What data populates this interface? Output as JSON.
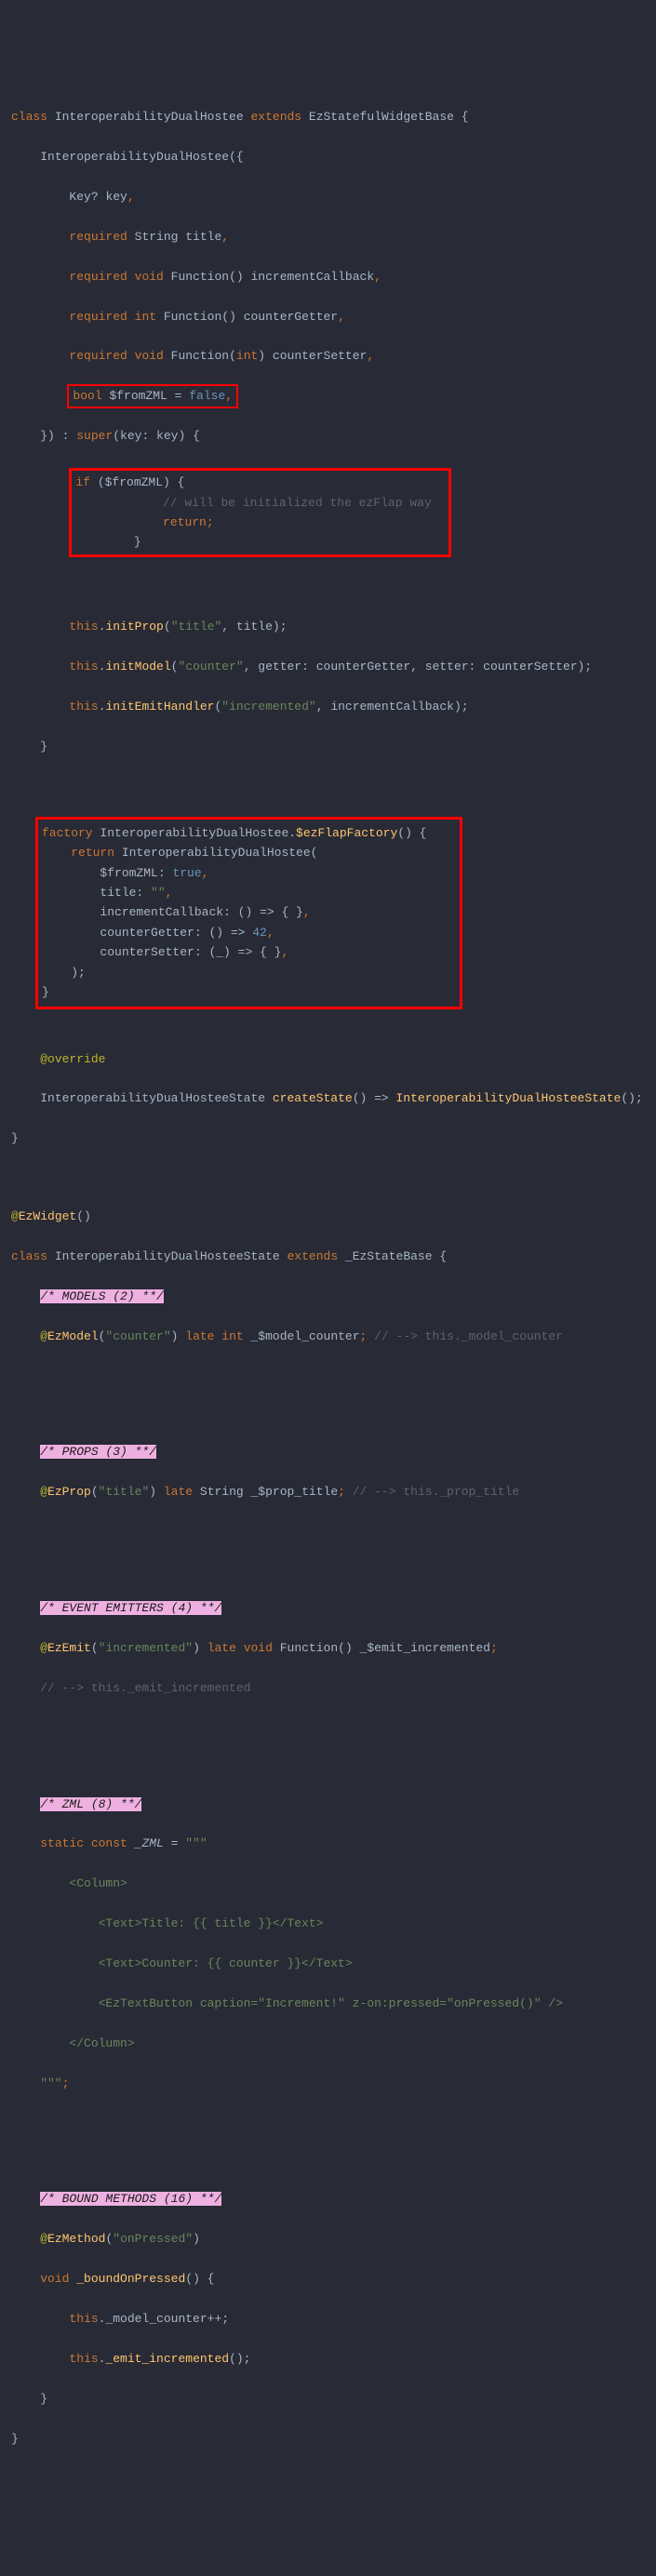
{
  "code": {
    "l1": {
      "class_kw": "class",
      "cls": "InteroperabilityDualHostee",
      "ext": "extends",
      "base": "EzStatefulWidgetBase",
      "brace": " {"
    },
    "l2": {
      "ctor": "InteroperabilityDualHostee",
      "open": "({"
    },
    "l3": {
      "type": "Key?",
      "name": " key",
      "c": ","
    },
    "l4": {
      "req": "required",
      "type": " String",
      "name": " title",
      "c": ","
    },
    "l5": {
      "req": "required",
      "type": " void ",
      "fn": "Function",
      "sig": "()",
      "name": " incrementCallback",
      "c": ","
    },
    "l6": {
      "req": "required",
      "type": " int ",
      "fn": "Function",
      "sig": "()",
      "name": " counterGetter",
      "c": ","
    },
    "l7": {
      "req": "required",
      "type": " void ",
      "fn": "Function",
      "sig": "(",
      "pt": "int",
      "sig2": ")",
      "name": " counterSetter",
      "c": ","
    },
    "l8": {
      "type": "bool",
      "name": " $fromZML = ",
      "val": "false",
      "c": ","
    },
    "l9": {
      "close": "}) : ",
      "superkw": "super",
      "args": "(key: key) {"
    },
    "l10": {
      "ifkw": "if ",
      "cond": "($fromZML) {"
    },
    "l11": {
      "cm": "// will be initialized the ezFlap way"
    },
    "l12": {
      "ret": "return",
      "sc": ";"
    },
    "l13": {
      "close": "}"
    },
    "l15": {
      "thiskw": "this",
      "dot": ".",
      "fn": "initProp",
      "open": "(",
      "s1": "\"title\"",
      "comma": ", title);"
    },
    "l16": {
      "thiskw": "this",
      "dot": ".",
      "fn": "initModel",
      "open": "(",
      "s1": "\"counter\"",
      "mid": ", getter: counterGetter, setter: counterSetter);"
    },
    "l17": {
      "thiskw": "this",
      "dot": ".",
      "fn": "initEmitHandler",
      "open": "(",
      "s1": "\"incremented\"",
      "mid": ", incrementCallback);"
    },
    "l18": {
      "close": "}"
    },
    "fac": {
      "l1": {
        "fac": "factory",
        "name": " InteroperabilityDualHostee.",
        "mname": "$ezFlapFactory",
        "sig": "() {"
      },
      "l2": {
        "ret": "return ",
        "ctor": "InteroperabilityDualHostee",
        "open": "("
      },
      "l3": {
        "k": "$fromZML: ",
        "v": "true",
        "c": ","
      },
      "l4": {
        "k": "title: ",
        "v": "\"\"",
        "c": ","
      },
      "l5": {
        "k": "incrementCallback: () => { }",
        "c": ","
      },
      "l6": {
        "k": "counterGetter: () => ",
        "v": "42",
        "c": ","
      },
      "l7": {
        "k": "counterSetter: (_) => { }",
        "c": ","
      },
      "l8": {
        "close": ");"
      },
      "l9": {
        "close": "}"
      }
    },
    "ov": {
      "ann": "@override"
    },
    "cs": {
      "ret": "InteroperabilityDualHosteeState ",
      "fn": "createState",
      "mid": "() => ",
      "ctor": "InteroperabilityDualHosteeState",
      "end": "();"
    },
    "end1": {
      "close": "}"
    },
    "wann": {
      "ann": "@",
      "fn": "EzWidget",
      "end": "()"
    },
    "cls2": {
      "class_kw": "class",
      "cls": "InteroperabilityDualHosteeState",
      "ext": "extends",
      "base": "_EzStateBase",
      "brace": " {"
    },
    "sec_models": "/* MODELS (2) **/",
    "mod1": {
      "ann": "@",
      "fn": "EzModel",
      "open": "(",
      "s": "\"counter\"",
      "close": ") ",
      "late": "late ",
      "t": "int",
      "name": " _$model_counter",
      "sc": ";",
      "cm": " // --> this._model_counter"
    },
    "sec_props": "/* PROPS (3) **/",
    "prop1": {
      "ann": "@",
      "fn": "EzProp",
      "open": "(",
      "s": "\"title\"",
      "close": ") ",
      "late": "late ",
      "t": "String",
      "name": " _$prop_title",
      "sc": ";",
      "cm": " // --> this._prop_title"
    },
    "sec_emit": "/* EVENT EMITTERS (4) **/",
    "emit1": {
      "ann": "@",
      "fn": "EzEmit",
      "open": "(",
      "s": "\"incremented\"",
      "close": ") ",
      "late": "late ",
      "t": "void ",
      "tfn": "Function",
      "sig": "()",
      "name": " _$emit_incremented",
      "sc": ";"
    },
    "emit2": {
      "cm": "// --> this._emit_incremented"
    },
    "sec_zml": "/* ZML (8) **/",
    "zml": {
      "l1": {
        "sc": "static const ",
        "name": "_ZML",
        "eq": " = ",
        "q": "\"\"\""
      },
      "l2": "        <Column>",
      "l3": "            <Text>Title: {{ title }}</Text>",
      "l4": "            <Text>Counter: {{ counter }}</Text>",
      "l5": "            <EzTextButton caption=\"Increment!\" z-on:pressed=\"onPressed()\" />",
      "l6": "        </Column>",
      "l7": {
        "q": "    \"\"\"",
        "sc": ";"
      }
    },
    "sec_bound": "/* BOUND METHODS (16) **/",
    "bnd": {
      "l1": {
        "ann": "@",
        "fn": "EzMethod",
        "open": "(",
        "s": "\"onPressed\"",
        "close": ")"
      },
      "l2": {
        "t": "void ",
        "fn": "_boundOnPressed",
        "sig": "() {"
      },
      "l3": {
        "thiskw": "this",
        "rest": "._model_counter++;"
      },
      "l4": {
        "thiskw": "this",
        "dot": ".",
        "fn": "_emit_incremented",
        "end": "();"
      },
      "l5": "    }",
      "l6": "}"
    }
  }
}
